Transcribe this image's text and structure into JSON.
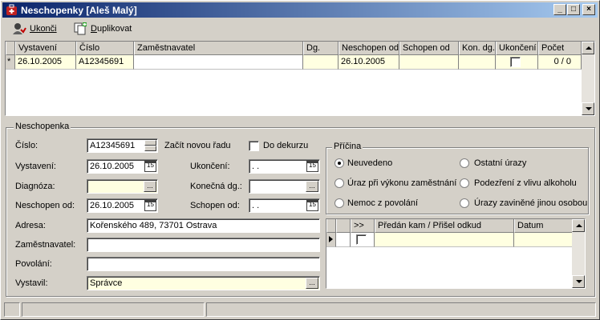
{
  "window": {
    "title": "Neschopenky [Aleš Malý]"
  },
  "title_buttons": {
    "minimize": "_",
    "maximize": "□",
    "close": "×"
  },
  "toolbar": {
    "ukonci_label": "Ukonči",
    "duplikovat_label": "Duplikovat"
  },
  "main_grid": {
    "columns": [
      "Vystavení",
      "Číslo",
      "Zaměstnavatel",
      "Dg.",
      "Neschopen od",
      "Schopen od",
      "Kon. dg.",
      "Ukončení",
      "Počet"
    ],
    "row_marker": "*",
    "row": {
      "vystaveni": "26.10.2005",
      "cislo": "A12345691",
      "zamestnavatel": "",
      "dg": "",
      "neschopen_od": "26.10.2005",
      "schopen_od": "",
      "kon_dg": "",
      "ukonceni": false,
      "pocet": "0 / 0"
    }
  },
  "form": {
    "group_label": "Neschopenka",
    "cislo": {
      "label": "Číslo:",
      "value": "A12345691"
    },
    "zacit_novou_radu": "Začít novou řadu",
    "do_dekurzu": {
      "label": "Do dekurzu",
      "checked": false
    },
    "vystaveni": {
      "label": "Vystavení:",
      "value": "26.10.2005"
    },
    "ukonceni": {
      "label": "Ukončení:",
      "value": ". ."
    },
    "diagnoza": {
      "label": "Diagnóza:",
      "value": ""
    },
    "konecna_dg": {
      "label": "Konečná dg.:",
      "value": ""
    },
    "neschopen_od": {
      "label": "Neschopen od:",
      "value": "26.10.2005"
    },
    "schopen_od": {
      "label": "Schopen od:",
      "value": ". ."
    },
    "adresa": {
      "label": "Adresa:",
      "value": "Kořenského 489, 73701 Ostrava"
    },
    "zamestnavatel": {
      "label": "Zaměstnavatel:",
      "value": ""
    },
    "povolani": {
      "label": "Povolání:",
      "value": ""
    },
    "vystavil": {
      "label": "Vystavil:",
      "value": "Správce"
    },
    "calendar_glyph": "15",
    "ellipsis": "..."
  },
  "pricina": {
    "label": "Příčina",
    "options": [
      {
        "label": "Neuvedeno",
        "selected": true
      },
      {
        "label": "Ostatní úrazy",
        "selected": false
      },
      {
        "label": "Úraz při výkonu zaměstnání",
        "selected": false
      },
      {
        "label": "Podezření z vlivu alkoholu",
        "selected": false
      },
      {
        "label": "Nemoc z povolání",
        "selected": false
      },
      {
        "label": "Úrazy zaviněné jinou osobou",
        "selected": false
      }
    ]
  },
  "predan_grid": {
    "columns": [
      ">>",
      "Předán kam / Přišel odkud",
      "Datum"
    ]
  }
}
